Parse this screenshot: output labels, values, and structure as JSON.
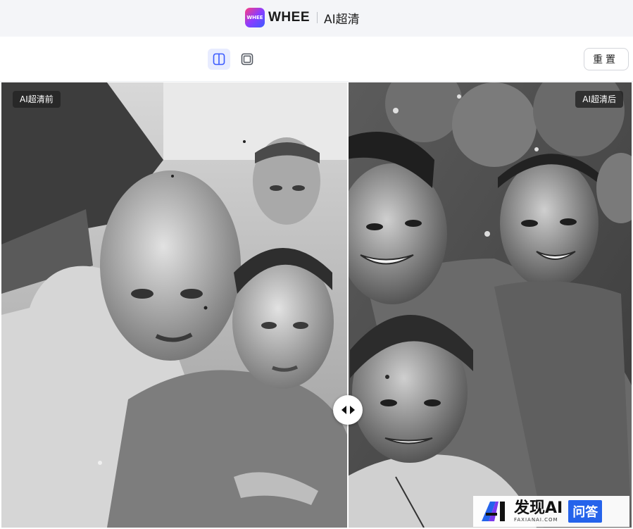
{
  "header": {
    "logo_text": "WHEE",
    "brand_name": "WHEE",
    "tool_title": "AI超清"
  },
  "toolbar": {
    "view_split_icon": "split-view-icon",
    "view_single_icon": "single-view-icon",
    "active_view": "split",
    "reset_label": "重置"
  },
  "compare": {
    "before_label": "AI超清前",
    "after_label": "AI超清后",
    "slider_position": 0.55
  },
  "watermark": {
    "main_text": "发现AI",
    "sub_text": "FAXIANAI.COM",
    "badge_text": "问答"
  },
  "colors": {
    "accent": "#3b5bff",
    "active_view_bg": "#e8ecff",
    "watermark_badge": "#2563eb"
  }
}
